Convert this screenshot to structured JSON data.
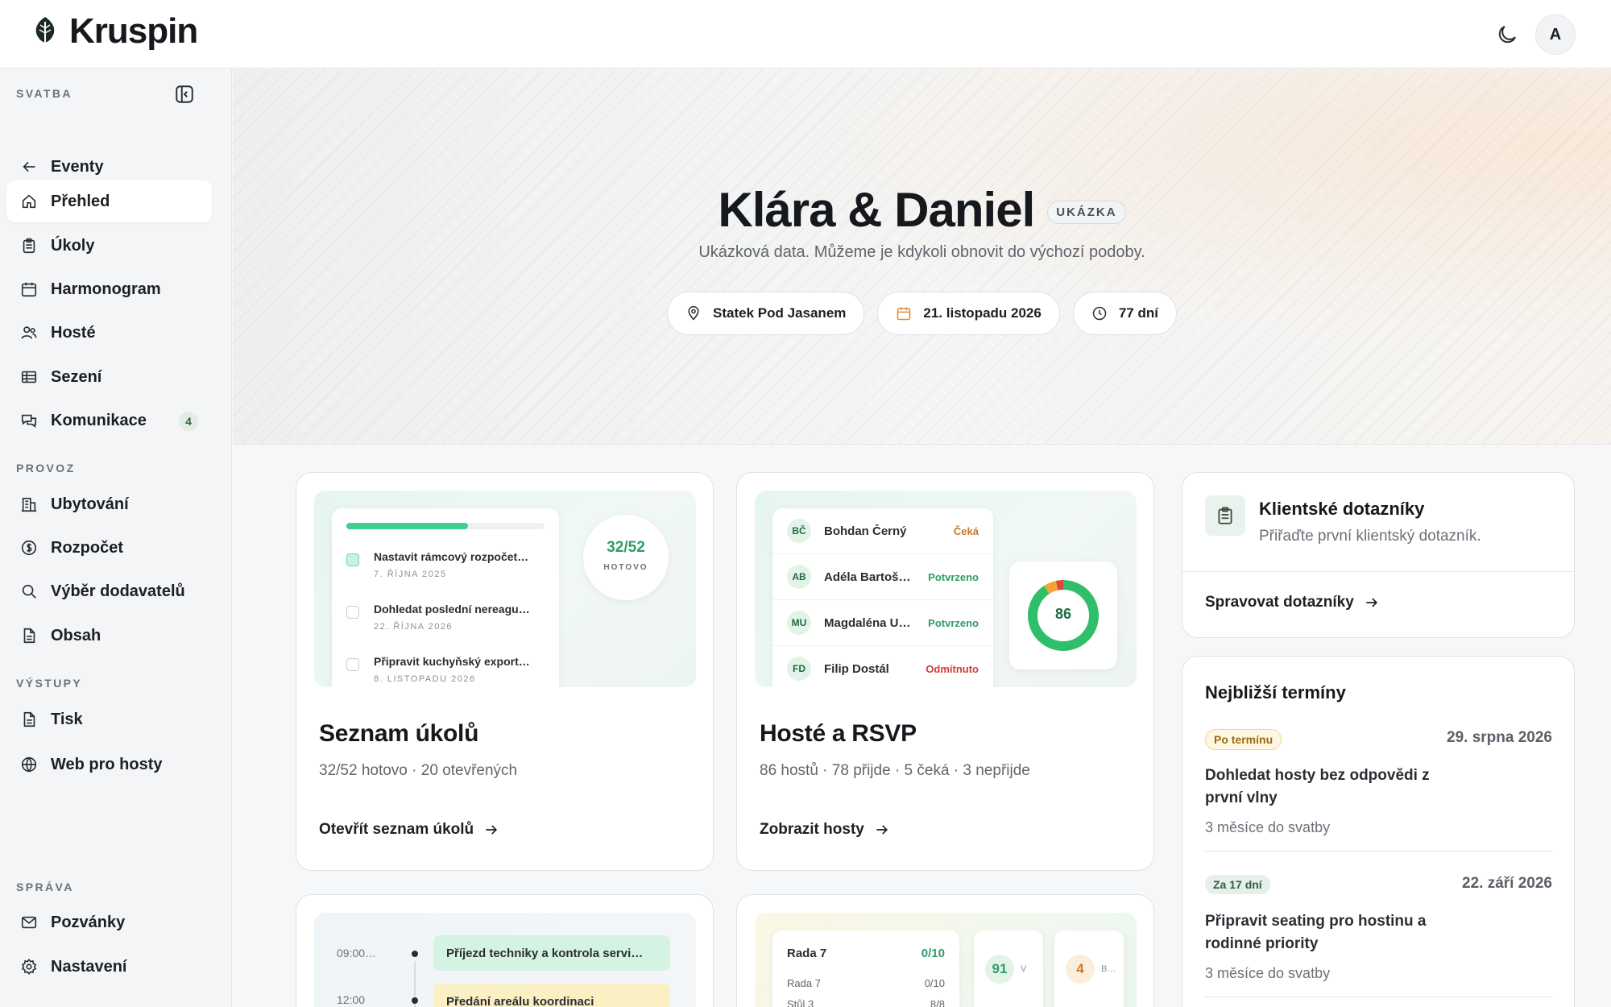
{
  "brand": {
    "name": "Kruspin"
  },
  "user": {
    "initial": "A"
  },
  "sidebar": {
    "sections": {
      "wedding": "SVATBA",
      "operations": "PROVOZ",
      "outputs": "VÝSTUPY",
      "admin": "SPRÁVA"
    },
    "back": "Eventy",
    "items": {
      "overview": "Přehled",
      "tasks": "Úkoly",
      "schedule": "Harmonogram",
      "guests": "Hosté",
      "seating": "Sezení",
      "communication": "Komunikace",
      "communication_badge": "4",
      "accommodation": "Ubytování",
      "budget": "Rozpočet",
      "vendors": "Výběr dodavatelů",
      "content": "Obsah",
      "print": "Tisk",
      "website": "Web pro hosty",
      "invitations": "Pozvánky",
      "settings": "Nastavení"
    }
  },
  "hero": {
    "title": "Klára & Daniel",
    "tag": "UKÁZKA",
    "subtitle": "Ukázková data. Můžeme je kdykoli obnovit do výchozí podoby.",
    "venue": "Statek Pod Jasanem",
    "date": "21. listopadu 2026",
    "countdown": "77 dní"
  },
  "tasks_card": {
    "title": "Seznam úkolů",
    "subtitle": "32/52 hotovo · 20 otevřených",
    "link": "Otevřít seznam úkolů",
    "progress_fraction": 0.615,
    "count": "32/52",
    "count_label": "HOTOVO",
    "items": [
      {
        "title": "Nastavit rámcový rozpočet…",
        "date": "7. ŘÍJNA 2025",
        "done": true
      },
      {
        "title": "Dohledat poslední nereagu…",
        "date": "22. ŘÍJNA 2026",
        "done": false
      },
      {
        "title": "Připravit kuchyňský export…",
        "date": "8. LISTOPADU 2026",
        "done": false
      }
    ]
  },
  "guests_card": {
    "title": "Hosté a RSVP",
    "subtitle": "86 hostů · 78 přijde · 5 čeká · 3 nepřijde",
    "link": "Zobrazit hosty",
    "total": "86",
    "breakdown": {
      "attending": 78,
      "pending": 5,
      "declined": 3
    },
    "colors": {
      "attending": "#2fbf6a",
      "pending": "#f2a33a",
      "declined": "#e0463b",
      "accepted_text": "#2f9c66",
      "pending_text": "#c7782a",
      "declined_text": "#d03b3b"
    },
    "rows": [
      {
        "initials": "BČ",
        "name": "Bohdan Černý",
        "status": "Čeká",
        "kind": "pending"
      },
      {
        "initials": "AB",
        "name": "Adéla Bartoš…",
        "status": "Potvrzeno",
        "kind": "accepted"
      },
      {
        "initials": "MU",
        "name": "Magdaléna U…",
        "status": "Potvrzeno",
        "kind": "accepted"
      },
      {
        "initials": "FD",
        "name": "Filip Dostál",
        "status": "Odmítnuto",
        "kind": "declined"
      }
    ]
  },
  "questionnaires": {
    "title": "Klientské dotazníky",
    "subtitle": "Přiřaďte první klientský dotazník.",
    "link": "Spravovat dotazníky"
  },
  "deadlines": {
    "title": "Nejbližší termíny",
    "items": [
      {
        "badge": "Po termínu",
        "date": "29. srpna 2026",
        "text": "Dohledat hosty bez odpovědi z první vlny",
        "meta": "3 měsíce do svatby",
        "kind": "overdue"
      },
      {
        "badge": "Za 17 dní",
        "date": "22. září 2026",
        "text": "Připravit seating pro hostinu a rodinné priority",
        "meta": "3 měsíce do svatby",
        "kind": "upcoming"
      }
    ]
  },
  "schedule_preview": {
    "items": [
      {
        "time": "09:00…",
        "event": "Příjezd techniky a kontrola servi…"
      },
      {
        "time": "12:00",
        "event": "Předání areálu koordinaci"
      }
    ]
  },
  "seating_preview": {
    "header": "Rada 7",
    "header_value": "0/10",
    "rows": [
      {
        "label": "Rada 7",
        "value": "0/10"
      },
      {
        "label": "Stůl 3",
        "value": "8/8"
      }
    ],
    "stat1": {
      "value": "91",
      "label": "V"
    },
    "stat2": {
      "value": "4",
      "label": "B…"
    }
  }
}
